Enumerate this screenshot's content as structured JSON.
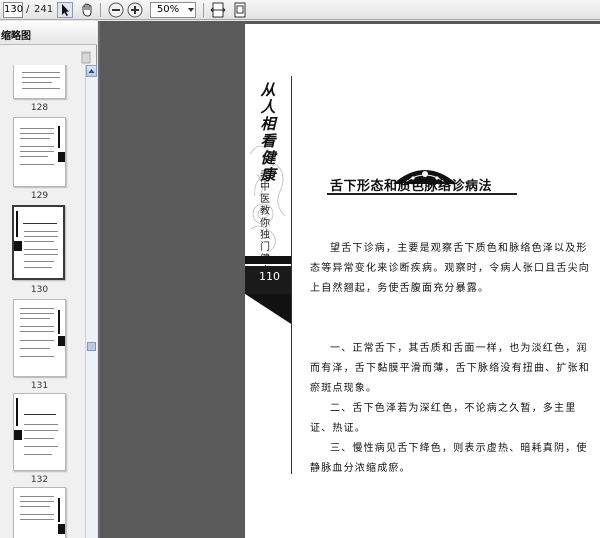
{
  "toolbar": {
    "page_current": "130",
    "page_sep": "/",
    "page_total": "241",
    "zoom": "50%",
    "icons": [
      "select-tool-icon",
      "hand-tool-icon",
      "zoom-out-icon",
      "zoom-in-icon",
      "fit-width-icon",
      "fit-page-icon"
    ]
  },
  "sidebar": {
    "title": "缩略图",
    "thumbnails": [
      {
        "label": "128"
      },
      {
        "label": "129"
      },
      {
        "label": "130"
      },
      {
        "label": "131"
      },
      {
        "label": "132"
      }
    ]
  },
  "page": {
    "vertical_title": "从人相看健康",
    "vertical_subtitle": "老中医教你独门健康望诊",
    "page_number": "110",
    "chapter_title": "舌下形态和质色脉络诊病法",
    "paragraphs": [
      "望舌下诊病，主要是观察舌下质色和脉络色泽以及形态等异常变化来诊断疾病。观察时，令病人张口且舌尖向上自然翘起，务使舌腹面充分暴露。",
      "一、正常舌下，其舌质和舌面一样，也为淡红色，润而有泽，舌下黏膜平滑而薄，舌下脉络没有扭曲、扩张和瘀斑点现象。",
      "二、舌下色泽若为深红色，不论病之久暂，多主里证、热证。",
      "三、慢性病见舌下绛色，则表示虚热、暗耗真阴，使静脉血分浓缩成瘀。"
    ]
  }
}
